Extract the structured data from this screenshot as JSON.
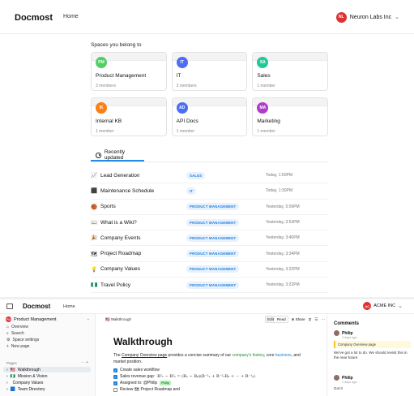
{
  "top": {
    "logo": "Docmost",
    "nav_home": "Home",
    "workspace": {
      "initials": "NL",
      "name": "Neuron Labs Inc",
      "color": "#e03131"
    },
    "spaces_title": "Spaces you belong to",
    "spaces": [
      {
        "initials": "PM",
        "name": "Product Management",
        "meta": "3 members",
        "color": "#51cf66"
      },
      {
        "initials": "IT",
        "name": "IT",
        "meta": "3 members",
        "color": "#4c6ef5"
      },
      {
        "initials": "SA",
        "name": "Sales",
        "meta": "1 member",
        "color": "#20c997"
      },
      {
        "initials": "IK",
        "name": "Internal KB",
        "meta": "1 member",
        "color": "#fd7e14"
      },
      {
        "initials": "AD",
        "name": "API Docs",
        "meta": "1 member",
        "color": "#4c6ef5"
      },
      {
        "initials": "MA",
        "name": "Marketing",
        "meta": "1 member",
        "color": "#ae3ec9"
      }
    ],
    "recent_tab": "Recently updated",
    "recent": [
      {
        "icon": "📈",
        "title": "Lead Generation",
        "space": "SALES",
        "date": "Today, 1:50PM"
      },
      {
        "icon": "⬛",
        "title": "Maintenance Schedule",
        "space": "IT",
        "date": "Today, 1:30PM"
      },
      {
        "icon": "🏀",
        "title": "Sports",
        "space": "PRODUCT MANAGEMENT",
        "date": "Yesterday, 5:09PM"
      },
      {
        "icon": "📖",
        "title": "What is a Wiki?",
        "space": "PRODUCT MANAGEMENT",
        "date": "Yesterday, 3:53PM"
      },
      {
        "icon": "🎉",
        "title": "Company Events",
        "space": "PRODUCT MANAGEMENT",
        "date": "Yesterday, 3:40PM"
      },
      {
        "icon": "🗺",
        "title": "Project Roadmap",
        "space": "PRODUCT MANAGEMENT",
        "date": "Yesterday, 3:34PM"
      },
      {
        "icon": "💡",
        "title": "Company Values",
        "space": "PRODUCT MANAGEMENT",
        "date": "Yesterday, 3:22PM"
      },
      {
        "icon": "🇳🇬",
        "title": "Travel Policy",
        "space": "PRODUCT MANAGEMENT",
        "date": "Yesterday, 3:22PM"
      }
    ]
  },
  "bottom": {
    "logo": "Docmost",
    "nav_home": "Home",
    "workspace": {
      "initials": "AC",
      "name": "ACME INC",
      "color": "#e03131"
    },
    "sidebar": {
      "space_initials": "PM",
      "space_name": "Product Management",
      "items": [
        "Overview",
        "Search",
        "Space settings",
        "New page"
      ],
      "pages_label": "Pages",
      "pages_actions": "··· +",
      "tree": [
        {
          "icon": "🇺🇸",
          "label": "Walkthrough",
          "active": true
        },
        {
          "icon": "🇳🇬",
          "label": "Mission & Vision",
          "active": false
        },
        {
          "icon": "",
          "label": "Company Values",
          "active": false
        },
        {
          "icon": "🟦",
          "label": "Team Directory",
          "active": false
        }
      ]
    },
    "page": {
      "breadcrumb": "🇺🇸 Walkthrough",
      "mode_edit": "Edit",
      "mode_read": "Read",
      "share": "Share",
      "title": "Walkthrough",
      "para_1": "The ",
      "para_link": "Company Overview page",
      "para_2": " provides a concise summary of our ",
      "para_hl1": "company's history",
      "para_3": ", core ",
      "para_hl2": "business",
      "para_4": ", and market position.",
      "tasks": [
        {
          "done": true,
          "text": "Create sales workflow"
        },
        {
          "done": true,
          "text": "Sales revenue gap: ",
          "math": "R²ₓ − R²ₛ = (Rₓ − R₀)(R⁻¹ₓ + R⁻²ₓR₃ + ··· + R⁻¹ₛ)"
        },
        {
          "done": true,
          "text": "Assigned to: @Philip",
          "tag": "Philip"
        },
        {
          "done": false,
          "text": "Review 🗺 Project Roadmap and"
        }
      ]
    },
    "comments": {
      "title": "Comments",
      "items": [
        {
          "author": "Philip",
          "time": "2 days ago",
          "quote": "Company Overview page",
          "text": "We've got a lot to do. We should revisit this in the near future."
        },
        {
          "author": "Philip",
          "time": "2 days ago",
          "text": "Got it"
        }
      ]
    }
  }
}
